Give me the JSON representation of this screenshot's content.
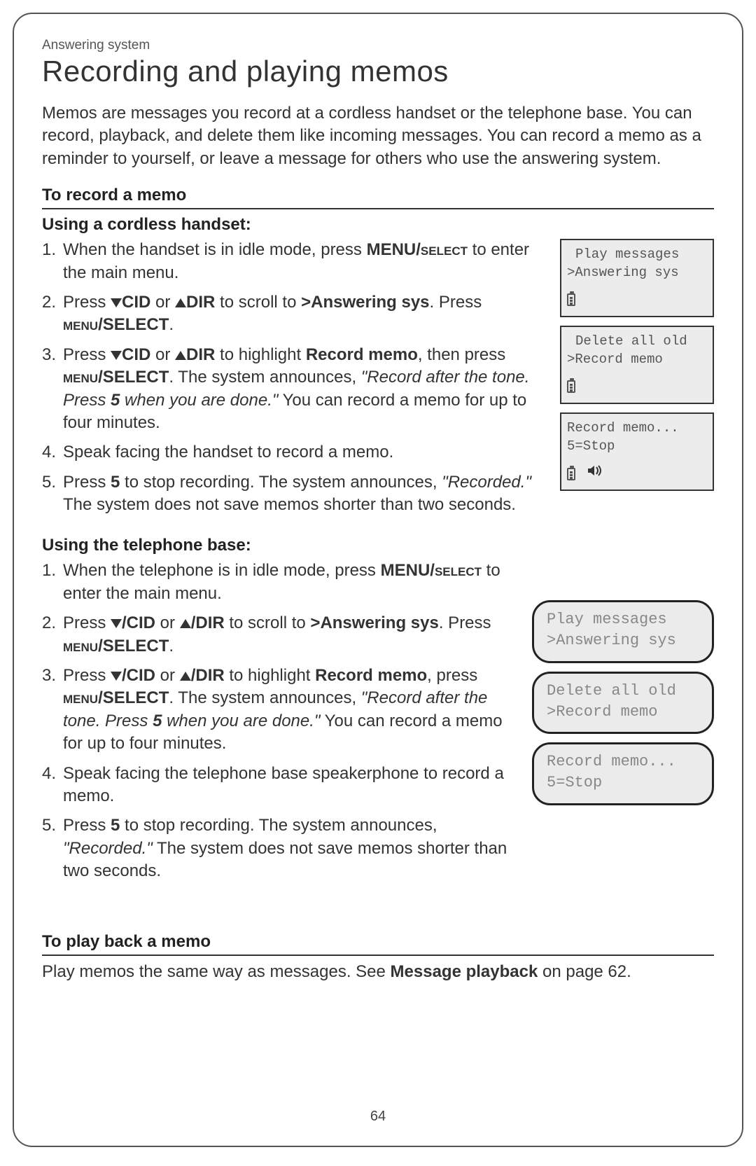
{
  "section_label": "Answering system",
  "title": "Recording and playing memos",
  "intro": "Memos are messages you record at a cordless handset or the telephone base. You can record, playback, and delete them like incoming messages. You can record a memo as a reminder to yourself, or leave a message for others who use the answering system.",
  "record_heading": "To record a memo",
  "handset_heading": "Using a cordless handset:",
  "base_heading": "Using the telephone base:",
  "playback_heading": "To play back a memo",
  "playback_text_pre": "Play memos the same way as messages. See ",
  "playback_text_bold": "Message playback",
  "playback_text_post": " on page 62.",
  "page_number": "64",
  "labels": {
    "cid": "CID",
    "dir": "DIR",
    "ans_sys": ">Answering sys",
    "record_memo": "Record memo",
    "five": "5",
    "slash_cid": "/CID",
    "slash_dir": "/DIR"
  },
  "announce": {
    "record_after": "\"Record after the tone. Press ",
    "when_done": " when you are done.\"",
    "recorded": "\"Recorded.\""
  },
  "handset_steps_text": {
    "s1_pre": "When the handset is in idle mode, press ",
    "s1_menu": "MENU/",
    "s1_select_sc": "select",
    "s1_post": " to enter the main menu.",
    "s2_pre": "Press ",
    "s2_or": " or ",
    "s2_to_scroll": " to scroll to ",
    "s2_press": ". Press ",
    "s2_menu_sc": "menu",
    "s2_select": "/SELECT",
    "s2_dot": ".",
    "s3_to_highlight": " to highlight ",
    "s3_then_press": ", then press ",
    "s3_sys_ann": ". The system announces, ",
    "s3_you_can": " You can record a memo for up to four minutes.",
    "s4": "Speak facing the handset to record a memo.",
    "s5_pre": "Press ",
    "s5_to_stop": " to stop recording. The system announces, ",
    "s5_tail": " The system does not save memos shorter than two seconds."
  },
  "base_steps_text": {
    "s1_pre": "When the telephone is in idle mode, press ",
    "s1_menu": "MENU/",
    "s1_select_sc": "select",
    "s1_post": " to enter the main menu.",
    "s3_press_prefix": ", press ",
    "s4": "Speak facing the telephone base speakerphone to record a memo."
  },
  "lcd_handset": [
    {
      "line1": "Play messages",
      "line2": ">Answering sys",
      "icons": "batt"
    },
    {
      "line1": "Delete all old",
      "line2": ">Record memo",
      "icons": "batt"
    },
    {
      "line1": "Record memo...",
      "line2": "5=Stop",
      "icons": "batt_spk"
    }
  ],
  "lcd_base": [
    {
      "line1": "Play messages",
      "line2": ">Answering sys"
    },
    {
      "line1": "Delete all old",
      "line2": ">Record memo"
    },
    {
      "line1": "Record memo...",
      "line2": "5=Stop"
    }
  ]
}
